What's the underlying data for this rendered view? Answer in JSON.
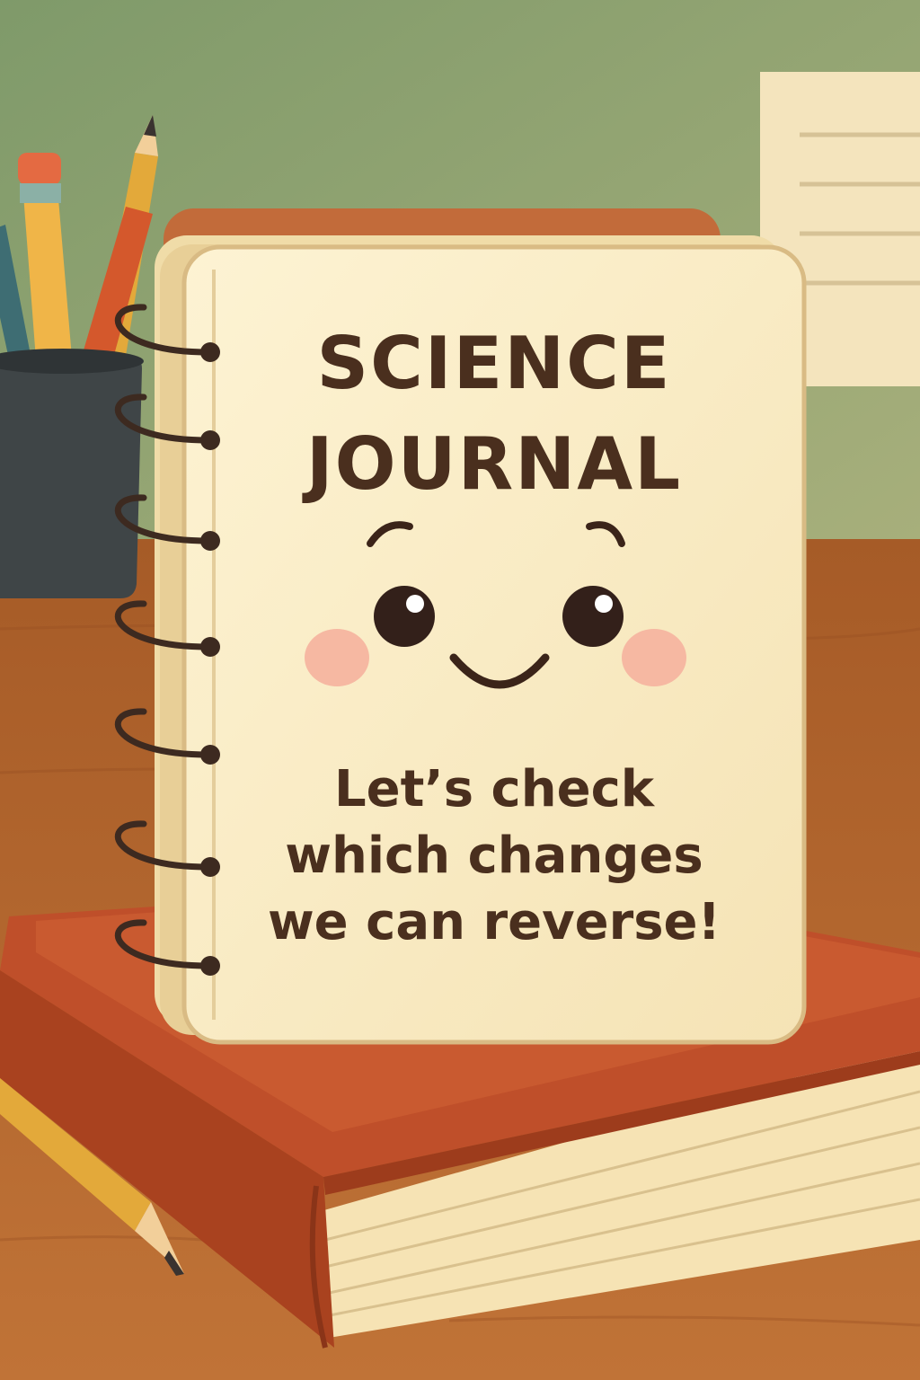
{
  "journal": {
    "title_line_1": "SCIENCE",
    "title_line_2": "JOURNAL",
    "message_line_1": "Let’s check",
    "message_line_2": "which changes",
    "message_line_3": "we can reverse!"
  },
  "colors": {
    "wall": "#9aa36f",
    "desk": "#b7672f",
    "cover": "#fbefc9",
    "text": "#4a2f1e",
    "book": "#c2532c",
    "cheeks": "#f6b8a2"
  }
}
